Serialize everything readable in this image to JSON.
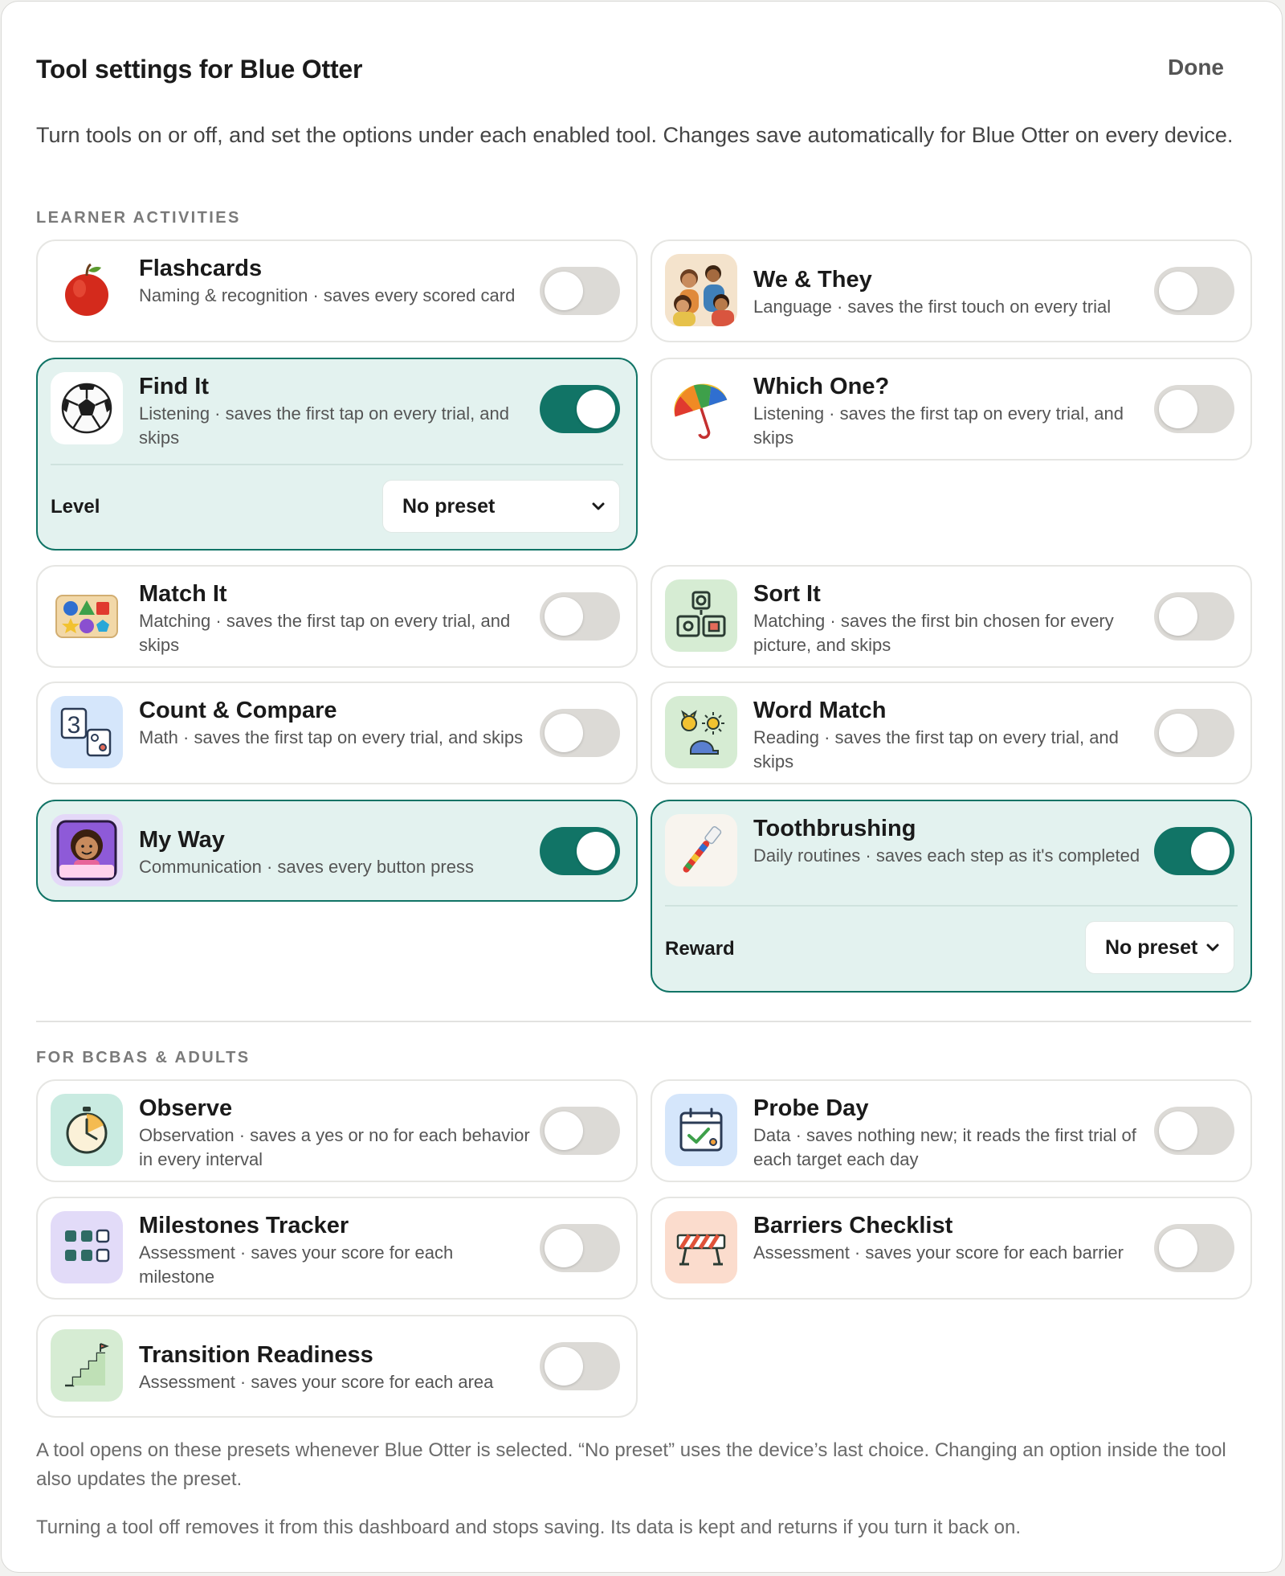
{
  "header": {
    "title": "Tool settings for Blue Otter",
    "done_label": "Done"
  },
  "intro": "Turn tools on or off, and set the options under each enabled tool. Changes save automatically for Blue Otter on every device.",
  "sections": {
    "learner": "LEARNER ACTIVITIES",
    "adults": "FOR BCBAS & ADULTS"
  },
  "tools": {
    "flashcards": {
      "title": "Flashcards",
      "desc": "Naming & recognition · saves every scored card",
      "enabled": false,
      "icon": "apple-icon"
    },
    "we_they": {
      "title": "We & They",
      "desc": "Language · saves the first touch on every trial",
      "enabled": false,
      "icon": "people-icon"
    },
    "find_it": {
      "title": "Find It",
      "desc": "Listening · saves the first tap on every trial, and skips",
      "enabled": true,
      "icon": "soccer-ball-icon",
      "option_label": "Level",
      "option_value": "No preset"
    },
    "which_one": {
      "title": "Which One?",
      "desc": "Listening · saves the first tap on every trial, and skips",
      "enabled": false,
      "icon": "umbrella-icon"
    },
    "match_it": {
      "title": "Match It",
      "desc": "Matching · saves the first tap on every trial, and skips",
      "enabled": false,
      "icon": "shape-sorter-icon"
    },
    "sort_it": {
      "title": "Sort It",
      "desc": "Matching · saves the first bin chosen for every picture, and skips",
      "enabled": false,
      "icon": "sort-bins-icon"
    },
    "count_compare": {
      "title": "Count & Compare",
      "desc": "Math · saves the first tap on every trial, and skips",
      "enabled": false,
      "icon": "number-dice-icon"
    },
    "word_match": {
      "title": "Word Match",
      "desc": "Reading · saves the first tap on every trial, and skips",
      "enabled": false,
      "icon": "word-pictures-icon"
    },
    "my_way": {
      "title": "My Way",
      "desc": "Communication · saves every button press",
      "enabled": true,
      "icon": "my-way-app-icon",
      "badge": "my way"
    },
    "toothbrushing": {
      "title": "Toothbrushing",
      "desc": "Daily routines · saves each step as it's completed",
      "enabled": true,
      "icon": "toothbrush-icon",
      "option_label": "Reward",
      "option_value": "No preset"
    },
    "observe": {
      "title": "Observe",
      "desc": "Observation · saves a yes or no for each behavior in every interval",
      "enabled": false,
      "icon": "stopwatch-icon"
    },
    "probe_day": {
      "title": "Probe Day",
      "desc": "Data · saves nothing new; it reads the first trial of each target each day",
      "enabled": false,
      "icon": "calendar-check-icon"
    },
    "milestones": {
      "title": "Milestones Tracker",
      "desc": "Assessment · saves your score for each milestone",
      "enabled": false,
      "icon": "grid-icon"
    },
    "barriers": {
      "title": "Barriers Checklist",
      "desc": "Assessment · saves your score for each barrier",
      "enabled": false,
      "icon": "barrier-icon"
    },
    "transition": {
      "title": "Transition Readiness",
      "desc": "Assessment · saves your score for each area",
      "enabled": false,
      "icon": "stairs-icon"
    }
  },
  "footer": {
    "note1": "A tool opens on these presets whenever Blue Otter is selected. “No preset” uses the device’s last choice. Changing an option inside the tool also updates the preset.",
    "note2": "Turning a tool off removes it from this dashboard and stops saving. Its data is kept and returns if you turn it back on."
  },
  "colors": {
    "accent": "#117466",
    "on_card_bg": "#e3f2ef",
    "toggle_off": "#dcdad6"
  }
}
